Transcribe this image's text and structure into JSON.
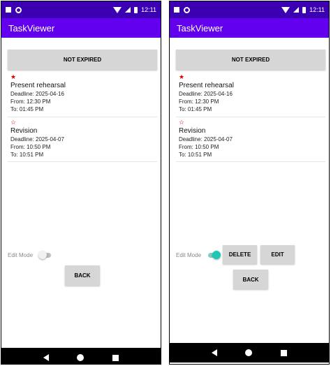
{
  "status_bar": {
    "time": "12:11"
  },
  "app": {
    "title": "TaskViewer"
  },
  "filter_button_label": "NOT EXPIRED",
  "tasks": [
    {
      "star": "★",
      "name": "Present rehearsal",
      "deadline": "Deadline: 2025-04-16",
      "from": "From: 12:30 PM",
      "to": "To: 01:45 PM"
    },
    {
      "star": "☆",
      "name": "Revision",
      "deadline": "Deadline: 2025-04-07",
      "from": "From: 10:50 PM",
      "to": "To: 10:51 PM"
    }
  ],
  "edit_mode": {
    "label": "Edit Mode",
    "left_state": "off",
    "right_state": "on"
  },
  "buttons": {
    "delete": "DELETE",
    "edit": "EDIT",
    "back": "BACK"
  },
  "colors": {
    "status_bar": "#3c00b3",
    "app_bar": "#6200ee",
    "toggle_on": "#1ec8b4",
    "star": "#e00000"
  }
}
